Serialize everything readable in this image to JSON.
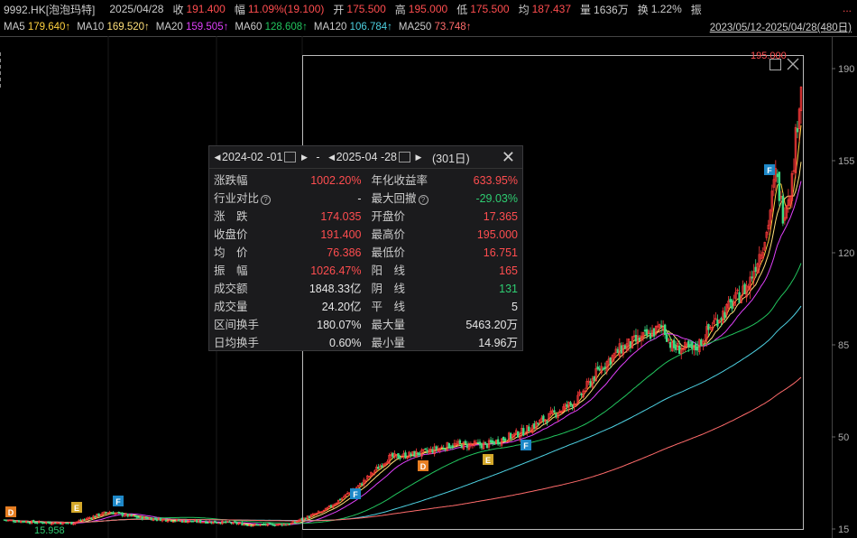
{
  "header": {
    "code_name": "9992.HK[泡泡玛特]",
    "date": "2025/04/28",
    "close_label": "收",
    "close_value": "191.400",
    "change_label": "幅",
    "change_value": "11.09%(19.100)",
    "open_label": "开",
    "open_value": "175.500",
    "high_label": "高",
    "high_value": "195.000",
    "low_label": "低",
    "low_value": "175.500",
    "avg_label": "均",
    "avg_value": "187.437",
    "volume_label": "量",
    "volume_value": "1636万",
    "turnover_label": "换",
    "turnover_value": "1.22%",
    "amp_label": "振",
    "more": "..."
  },
  "ma": [
    {
      "label": "MA5",
      "value": "179.640↑",
      "color": "#ffd23f"
    },
    {
      "label": "MA10",
      "value": "169.520↑",
      "color": "#ffe07a"
    },
    {
      "label": "MA20",
      "value": "159.505↑",
      "color": "#e040fb"
    },
    {
      "label": "MA60",
      "value": "128.608↑",
      "color": "#22c55e"
    },
    {
      "label": "MA120",
      "value": "106.784↑",
      "color": "#4dd0e1"
    },
    {
      "label": "MA250",
      "value": "73.748↑",
      "color": "#ff6b6b"
    }
  ],
  "range_link": "2023/05/12-2025/04/28(480日)",
  "chart": {
    "y_ticks": [
      "190",
      "155",
      "120",
      "85",
      "50",
      "15"
    ],
    "max_label": "195.000",
    "min_label": "15.958",
    "markers": [
      {
        "letter": "D",
        "color": "#e67e22"
      },
      {
        "letter": "E",
        "color": "#d4a82a"
      },
      {
        "letter": "F",
        "color": "#1e88c8"
      },
      {
        "letter": "F",
        "color": "#1e88c8"
      },
      {
        "letter": "D",
        "color": "#e67e22"
      },
      {
        "letter": "E",
        "color": "#d4a82a"
      },
      {
        "letter": "F",
        "color": "#1e88c8"
      },
      {
        "letter": "F",
        "color": "#1e88c8"
      }
    ]
  },
  "popup": {
    "start_date": "2024-02 -01",
    "separator": "-",
    "end_date": "2025-04 -28",
    "days": "(301日)",
    "rows": [
      {
        "k1": "涨跌幅",
        "v1": "1002.20%",
        "c1": "red",
        "k2": "年化收益率",
        "v2": "633.95%",
        "c2": "red"
      },
      {
        "k1": "行业对比",
        "q1": true,
        "v1": "-",
        "c1": "white",
        "k2": "最大回撤",
        "q2": true,
        "v2": "-29.03%",
        "c2": "green"
      },
      {
        "k1": "涨　跌",
        "v1": "174.035",
        "c1": "red",
        "k2": "开盘价",
        "v2": "17.365",
        "c2": "red"
      },
      {
        "k1": "收盘价",
        "v1": "191.400",
        "c1": "red",
        "k2": "最高价",
        "v2": "195.000",
        "c2": "red"
      },
      {
        "k1": "均　价",
        "v1": "76.386",
        "c1": "red",
        "k2": "最低价",
        "v2": "16.751",
        "c2": "red"
      },
      {
        "k1": "振　幅",
        "v1": "1026.47%",
        "c1": "red",
        "k2": "阳　线",
        "v2": "165",
        "c2": "red"
      },
      {
        "k1": "成交额",
        "v1": "1848.33亿",
        "c1": "white",
        "k2": "阴　线",
        "v2": "131",
        "c2": "green"
      },
      {
        "k1": "成交量",
        "v1": "24.20亿",
        "c1": "white",
        "k2": "平　线",
        "v2": "5",
        "c2": "white"
      },
      {
        "k1": "区间换手",
        "v1": "180.07%",
        "c1": "white",
        "k2": "最大量",
        "v2": "5463.20万",
        "c2": "white"
      },
      {
        "k1": "日均换手",
        "v1": "0.60%",
        "c1": "white",
        "k2": "最小量",
        "v2": "14.96万",
        "c2": "white"
      }
    ]
  }
}
